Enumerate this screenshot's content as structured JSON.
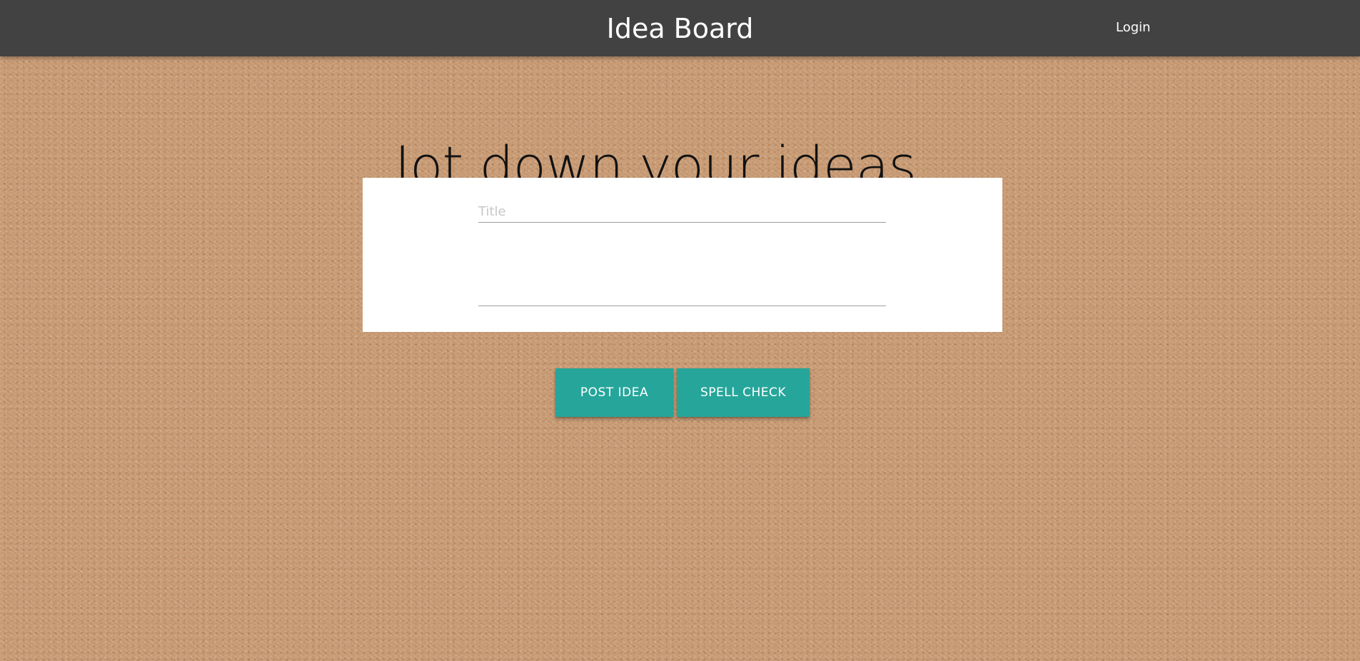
{
  "header": {
    "title": "Idea Board",
    "login_label": "Login"
  },
  "main": {
    "headline": "Jot down your ideas..."
  },
  "form": {
    "title_placeholder": "Title",
    "title_value": "",
    "body_placeholder": "",
    "body_value": ""
  },
  "actions": {
    "post_label": "POST IDEA",
    "spell_check_label": "SPELL CHECK"
  },
  "colors": {
    "topbar": "#424242",
    "button": "#26a69a",
    "background": "#c89a72",
    "card": "#ffffff"
  }
}
